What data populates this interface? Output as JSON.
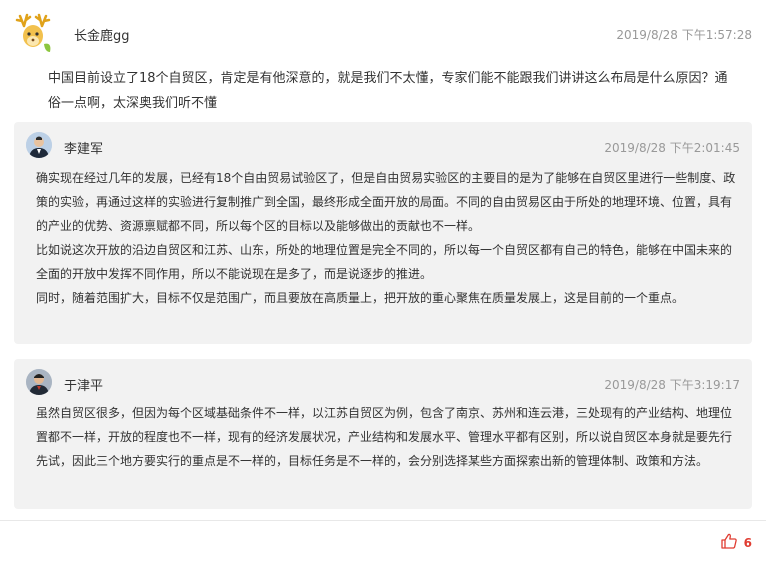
{
  "question": {
    "author": "长金鹿gg",
    "time": "2019/8/28 下午1:57:28",
    "text": "中国目前设立了18个自贸区，肯定是有他深意的，就是我们不太懂，专家们能不能跟我们讲讲这么布局是什么原因？通俗一点啊，太深奥我们听不懂",
    "avatar_icon": "deer-avatar-icon"
  },
  "replies": [
    {
      "author": "李建军",
      "time": "2019/8/28 下午2:01:45",
      "paragraphs": [
        "确实现在经过几年的发展，已经有18个自由贸易试验区了，但是自由贸易实验区的主要目的是为了能够在自贸区里进行一些制度、政策的实验，再通过这样的实验进行复制推广到全国，最终形成全面开放的局面。不同的自由贸易区由于所处的地理环境、位置，具有的产业的优势、资源禀赋都不同，所以每个区的目标以及能够做出的贡献也不一样。",
        "比如说这次开放的沿边自贸区和江苏、山东，所处的地理位置是完全不同的，所以每一个自贸区都有自己的特色，能够在中国未来的全面的开放中发挥不同作用，所以不能说现在是多了，而是说逐步的推进。",
        "同时，随着范围扩大，目标不仅是范围广，而且要放在高质量上，把开放的重心聚焦在质量发展上，这是目前的一个重点。"
      ]
    },
    {
      "author": "于津平",
      "time": "2019/8/28 下午3:19:17",
      "paragraphs": [
        "虽然自贸区很多，但因为每个区域基础条件不一样，以江苏自贸区为例，包含了南京、苏州和连云港，三处现有的产业结构、地理位置都不一样，开放的程度也不一样，现有的经济发展状况，产业结构和发展水平、管理水平都有区别，所以说自贸区本身就是要先行先试，因此三个地方要实行的重点是不一样的，目标任务是不一样的，会分别选择某些方面探索出新的管理体制、政策和方法。"
      ]
    }
  ],
  "footer": {
    "like_count": "6",
    "like_icon": "thumbs-up-icon",
    "like_color": "#e03c31"
  }
}
